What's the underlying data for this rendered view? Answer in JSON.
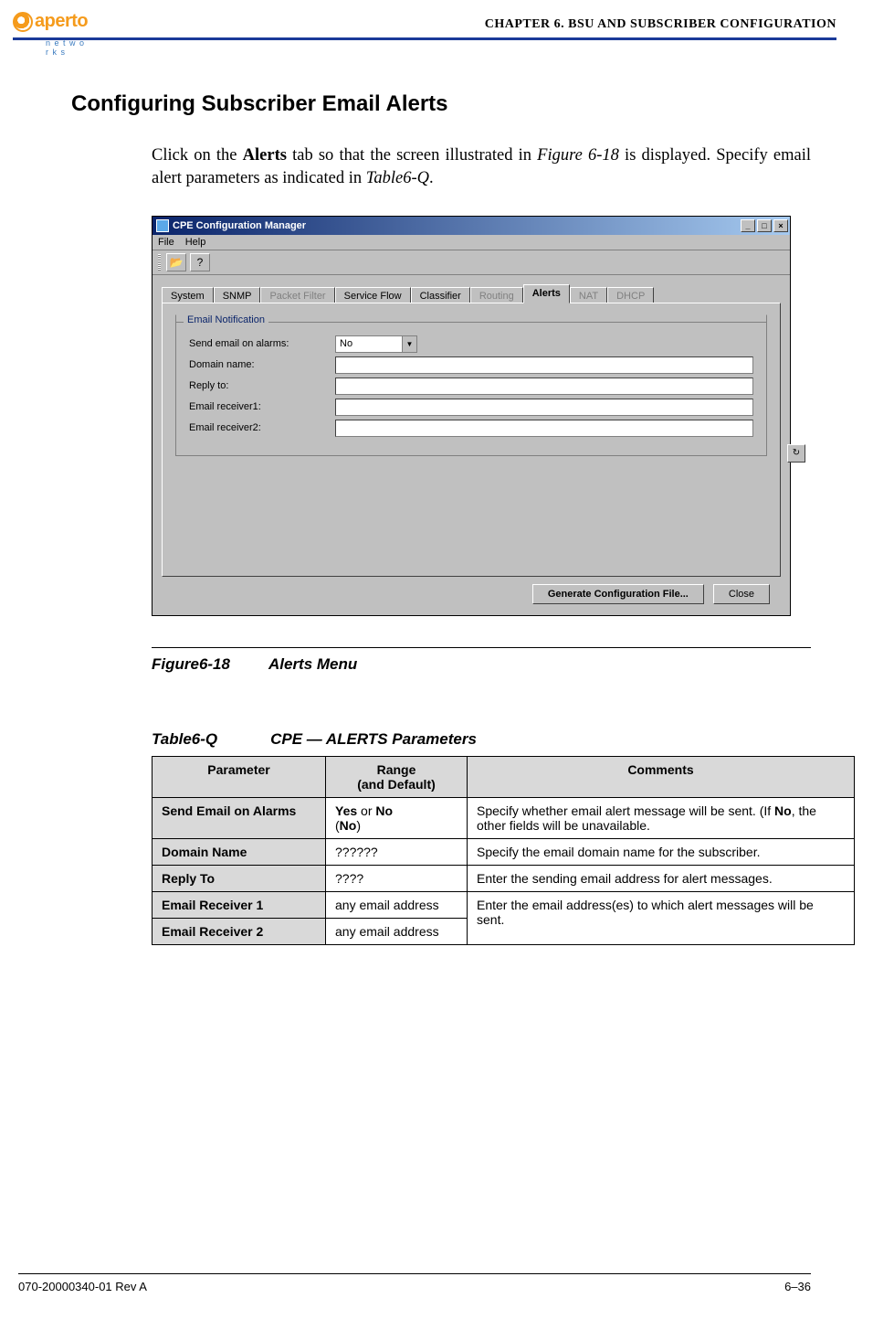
{
  "header": {
    "logo_text": "aperto",
    "logo_sub": "n e t w o r k s",
    "chapter": "CHAPTER 6.   BSU AND SUBSCRIBER CONFIGURATION"
  },
  "section": {
    "heading": "Configuring Subscriber Email Alerts",
    "para_pre": "Click on the ",
    "para_bold1": "Alerts",
    "para_mid1": " tab so that the screen illustrated in ",
    "para_ital1": "Figure 6-18",
    "para_mid2": " is displayed. Specify email alert parameters as indicated in ",
    "para_ital2": "Table6-Q",
    "para_end": "."
  },
  "window": {
    "title": "CPE Configuration Manager",
    "menu": {
      "file": "File",
      "help": "Help"
    },
    "tabs": {
      "system": "System",
      "snmp": "SNMP",
      "packet_filter": "Packet Filter",
      "service_flow": "Service Flow",
      "classifier": "Classifier",
      "routing": "Routing",
      "alerts": "Alerts",
      "nat": "NAT",
      "dhcp": "DHCP"
    },
    "group_legend": "Email Notification",
    "labels": {
      "send": "Send email on alarms:",
      "domain": "Domain name:",
      "reply": "Reply to:",
      "r1": "Email receiver1:",
      "r2": "Email receiver2:"
    },
    "combo_value": "No",
    "buttons": {
      "generate": "Generate Configuration File...",
      "close": "Close"
    }
  },
  "figure": {
    "num": "Figure6-18",
    "title": "Alerts Menu"
  },
  "table": {
    "num": "Table6-Q",
    "title": "CPE — ALERTS Parameters",
    "headers": {
      "param": "Parameter",
      "range": "Range\n(and Default)",
      "comments": "Comments"
    },
    "rows": {
      "r1": {
        "p": "Send Email on Alarms",
        "range_b1": "Yes",
        "range_t1": " or ",
        "range_b2": "No",
        "range_br": "(",
        "range_b3": "No",
        "range_close": ")",
        "c_pre": "Specify whether email alert message will be sent. (If ",
        "c_b": "No",
        "c_post": ", the other fields will be unavailable."
      },
      "r2": {
        "p": "Domain Name",
        "r": "??????",
        "c": "Specify the email domain name for the subscriber."
      },
      "r3": {
        "p": "Reply To",
        "r": "????",
        "c": "Enter the sending email address for alert messages."
      },
      "r4": {
        "p": "Email Receiver 1",
        "r": "any email address",
        "c": "Enter the email address(es) to which alert messages will be sent."
      },
      "r5": {
        "p": "Email Receiver 2",
        "r": "any email address"
      }
    }
  },
  "footer": {
    "left": "070-20000340-01 Rev A",
    "right": "6–36"
  }
}
